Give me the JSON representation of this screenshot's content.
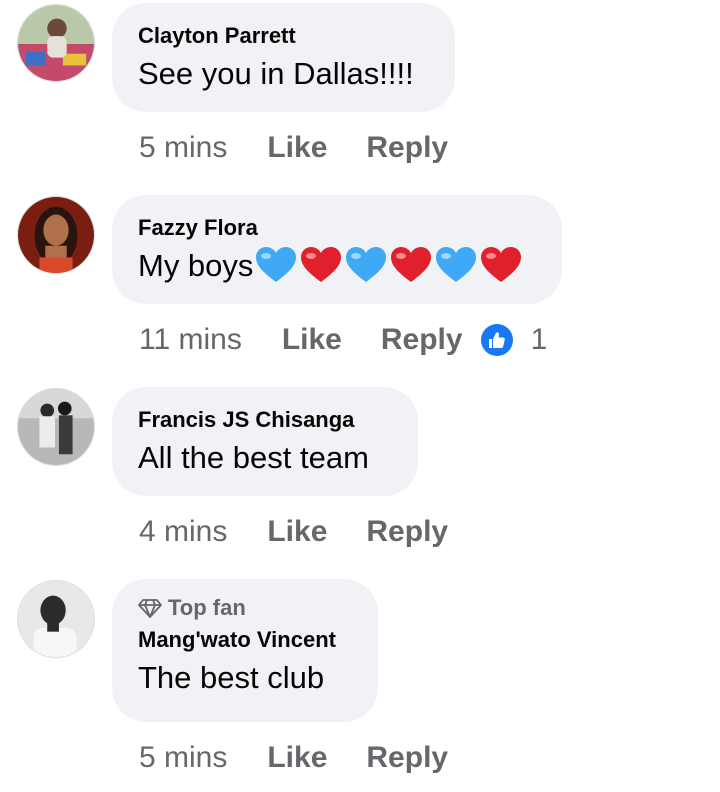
{
  "comments": [
    {
      "author": "Clayton Parrett",
      "text": "See you in Dallas!!!!",
      "time": "5 mins",
      "like_label": "Like",
      "reply_label": "Reply"
    },
    {
      "author": "Fazzy Flora",
      "text": "My boys",
      "emojis": [
        "blue-heart",
        "red-heart",
        "blue-heart",
        "red-heart",
        "blue-heart",
        "red-heart"
      ],
      "time": "11 mins",
      "like_label": "Like",
      "reply_label": "Reply",
      "reaction_count": "1"
    },
    {
      "author": "Francis JS Chisanga",
      "text": "All the best team",
      "time": "4 mins",
      "like_label": "Like",
      "reply_label": "Reply"
    },
    {
      "badge": "Top fan",
      "author": "Mang'wato Vincent",
      "text": "The best club",
      "time": "5 mins",
      "like_label": "Like",
      "reply_label": "Reply"
    }
  ],
  "colors": {
    "bubble": "#f0f2f5",
    "meta_text": "#65676b",
    "name_text": "#050505",
    "like_blue": "#1877f2",
    "red_heart": "#e0202c",
    "blue_heart": "#3fa9f5"
  }
}
